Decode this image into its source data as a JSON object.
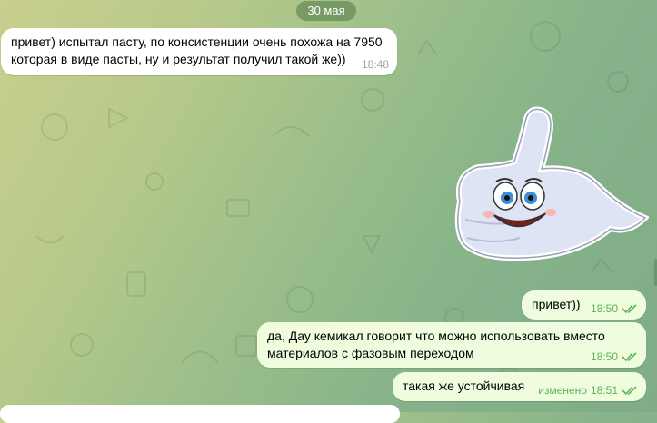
{
  "date_separator": "30 мая",
  "messages": [
    {
      "direction": "incoming",
      "text": "привет) испытал пасту, по консистенции очень похожа на 7950\nкоторая в виде пасты, ну и результат получил такой же))",
      "time": "18:48"
    },
    {
      "direction": "outgoing",
      "type": "sticker",
      "sticker_icon": "smiling-thumbs-up-sticker"
    },
    {
      "direction": "outgoing",
      "text": "привет))",
      "time": "18:50",
      "status": "read"
    },
    {
      "direction": "outgoing",
      "text": "да, Дау кемикал говорит что можно использовать вместо\nматериалов с фазовым переходом",
      "time": "18:50",
      "status": "read"
    },
    {
      "direction": "outgoing",
      "text": "такая же устойчивая",
      "edited_label": "изменено",
      "time": "18:51",
      "status": "read"
    }
  ],
  "colors": {
    "incoming_bubble": "#ffffff",
    "outgoing_bubble": "#effdde",
    "read_ticks": "#5fb15a",
    "date_pill": "#6f9a5c"
  }
}
